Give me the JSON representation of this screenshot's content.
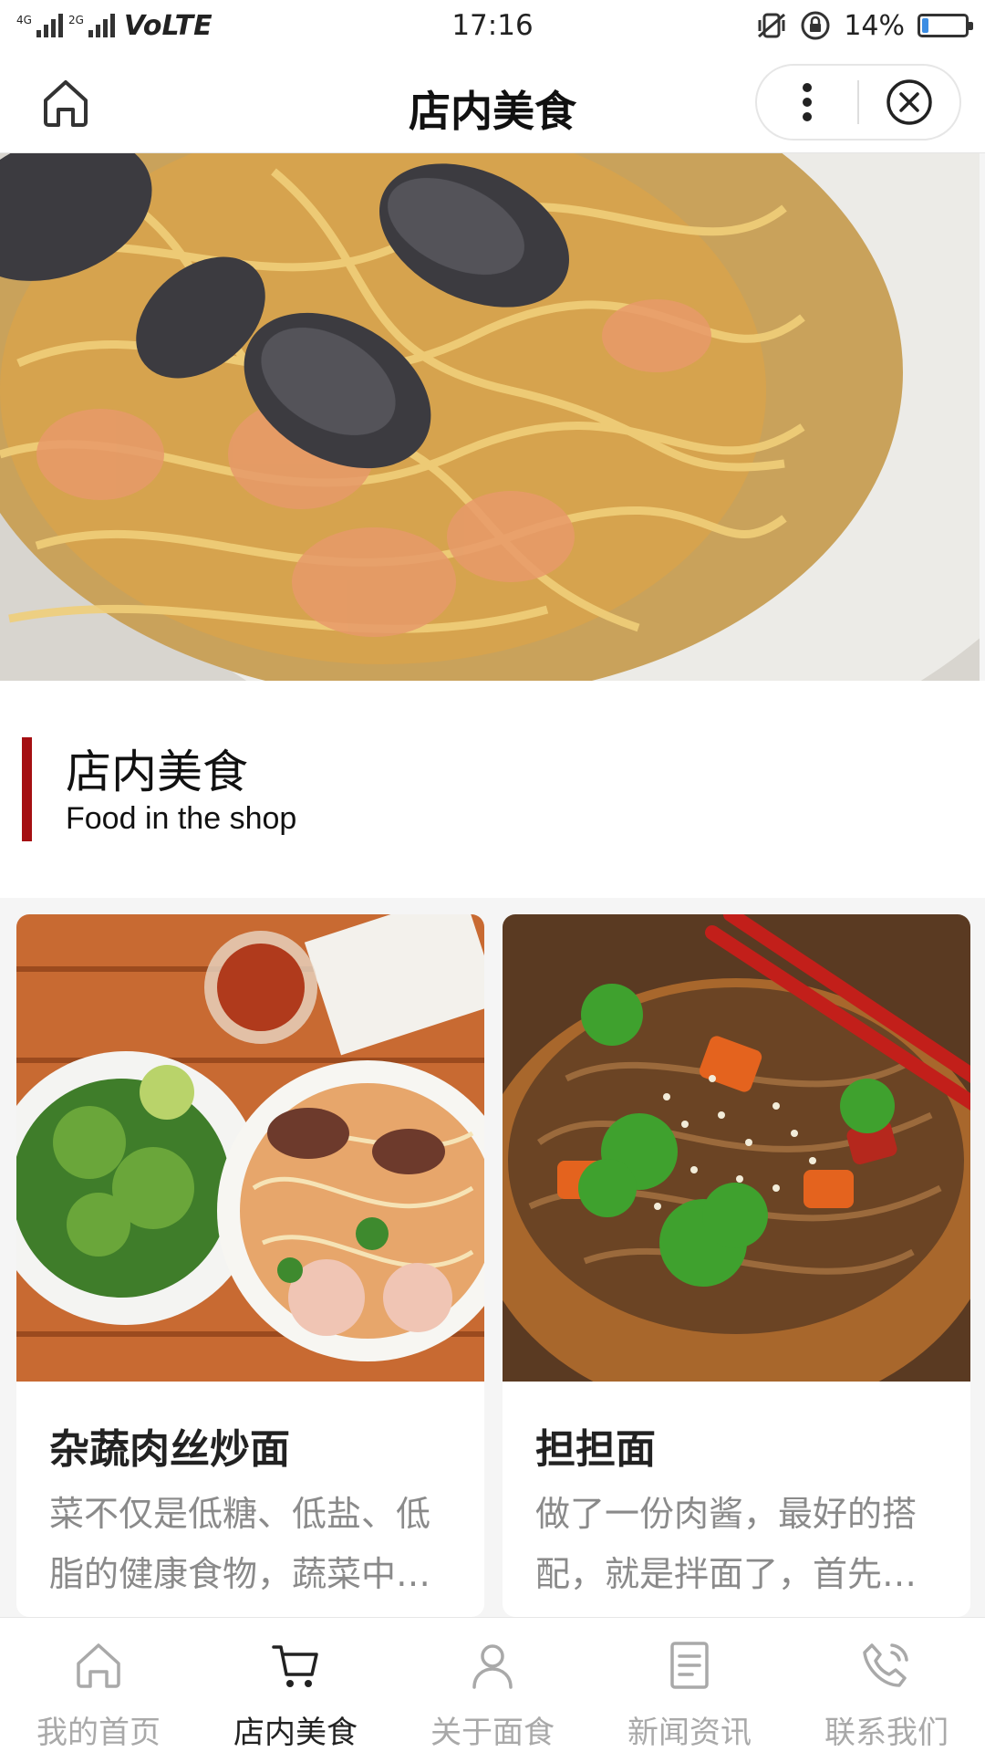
{
  "status_bar": {
    "network": "4G",
    "network2": "2G",
    "volte": "VoLTE",
    "time": "17:16",
    "battery": "14%",
    "battery_level": 0.14
  },
  "header": {
    "title": "店内美食"
  },
  "section": {
    "title_cn": "店内美食",
    "title_en": "Food in the shop",
    "accent_color": "#a50f12"
  },
  "items": [
    {
      "name": "杂蔬肉丝炒面",
      "desc": "菜不仅是低糖、低盐、低脂的健康食物，蔬菜中…"
    },
    {
      "name": "担担面",
      "desc": "做了一份肉酱，最好的搭配，就是拌面了，首先…"
    }
  ],
  "tabbar": {
    "tabs": [
      {
        "label": "我的首页",
        "icon": "home-icon",
        "active": false
      },
      {
        "label": "店内美食",
        "icon": "cart-icon",
        "active": true
      },
      {
        "label": "关于面食",
        "icon": "person-icon",
        "active": false
      },
      {
        "label": "新闻资讯",
        "icon": "document-icon",
        "active": false
      },
      {
        "label": "联系我们",
        "icon": "phone-icon",
        "active": false
      }
    ]
  }
}
